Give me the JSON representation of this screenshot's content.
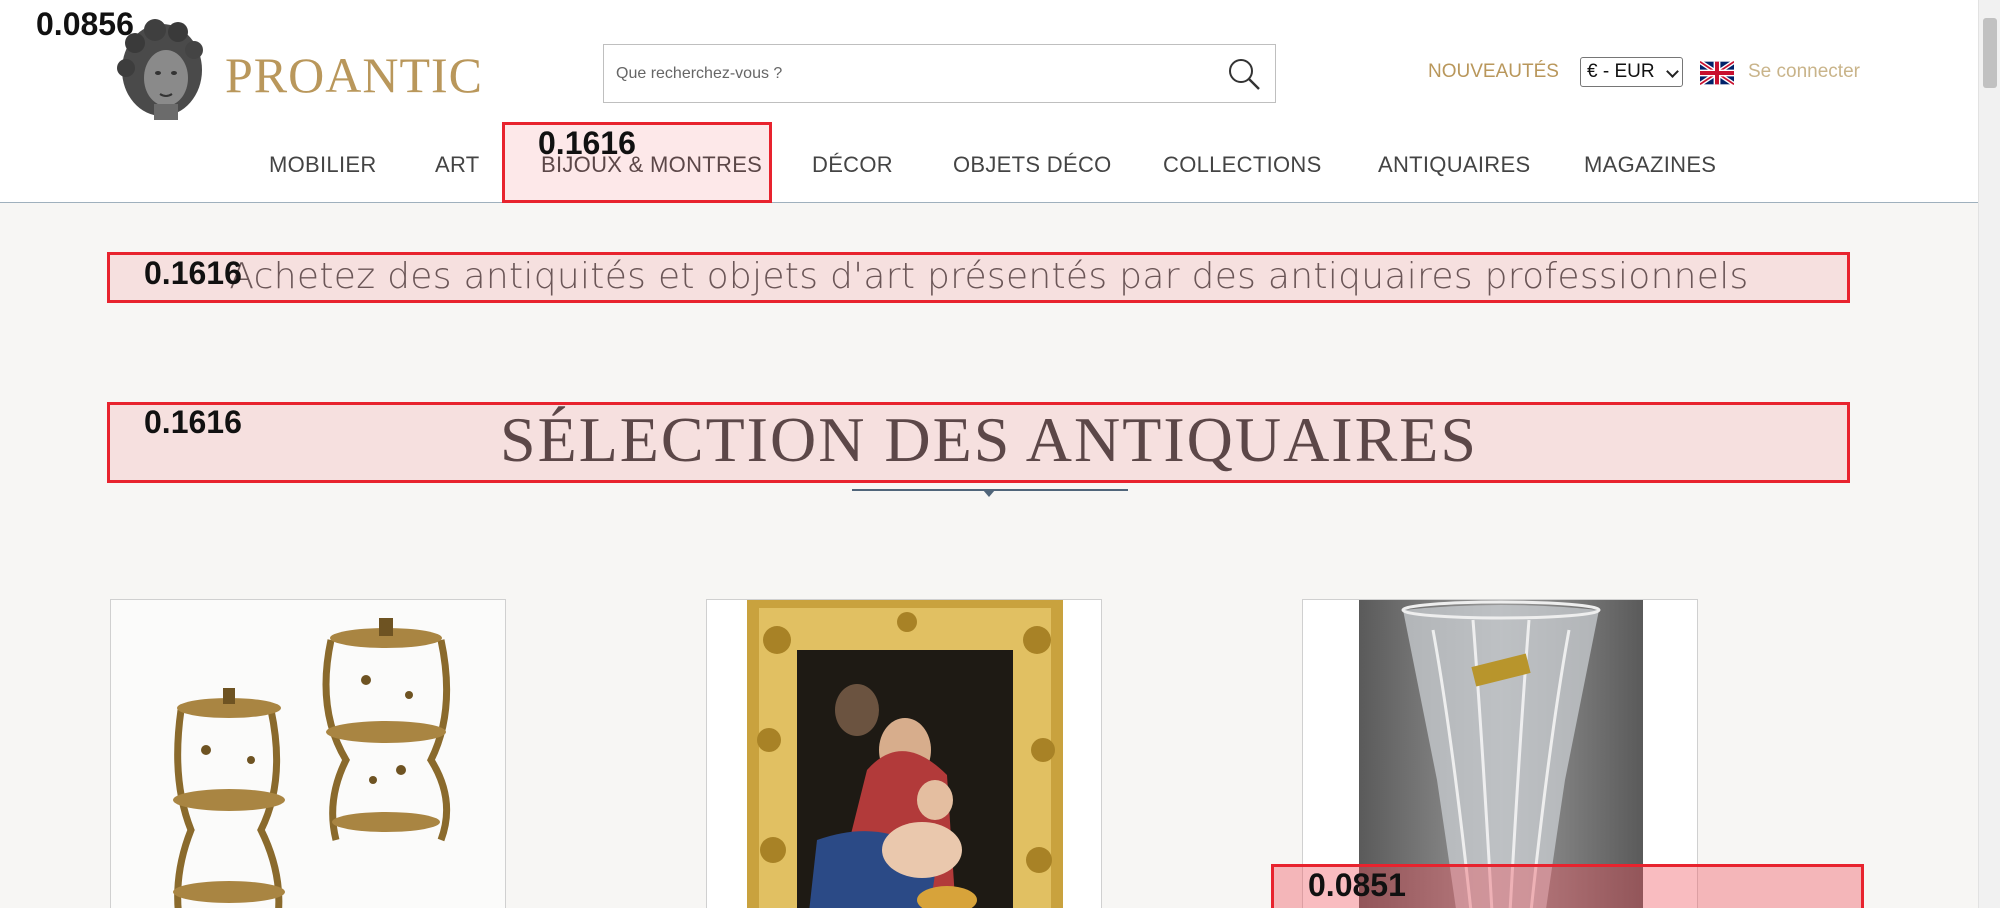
{
  "header": {
    "logo_text": "PROANTIC",
    "search": {
      "placeholder": "Que recherchez-vous ?"
    },
    "nouveautes_label": "NOUVEAUTÉS",
    "currency": {
      "selected": "€ - EUR"
    },
    "language_flag": "uk-flag-icon",
    "login_label": "Se connecter"
  },
  "nav": {
    "items": [
      {
        "label": "MOBILIER"
      },
      {
        "label": "ART"
      },
      {
        "label": "BIJOUX & MONTRES"
      },
      {
        "label": "DÉCOR"
      },
      {
        "label": "OBJETS DÉCO"
      },
      {
        "label": "COLLECTIONS"
      },
      {
        "label": "ANTIQUAIRES"
      },
      {
        "label": "MAGAZINES"
      }
    ]
  },
  "main": {
    "tagline": "Achetez des antiquités et objets d'art présentés par des antiquaires professionnels",
    "section_title": "SÉLECTION DES ANTIQUAIRES",
    "products": [
      {
        "image": "gilded-wall-shelves-image"
      },
      {
        "image": "madonna-and-child-painting-image"
      },
      {
        "image": "crystal-vase-image"
      }
    ]
  },
  "overlays": {
    "corner": "0.0856",
    "nav_highlight": "0.1616",
    "tagline_highlight": "0.1616",
    "title_highlight": "0.1616",
    "card_highlight": "0.0851"
  },
  "colors": {
    "brand_gold": "#b9975b",
    "login_text": "#c9b48a",
    "overlay_red": "#e8232e",
    "rule_blue": "#50657a"
  }
}
